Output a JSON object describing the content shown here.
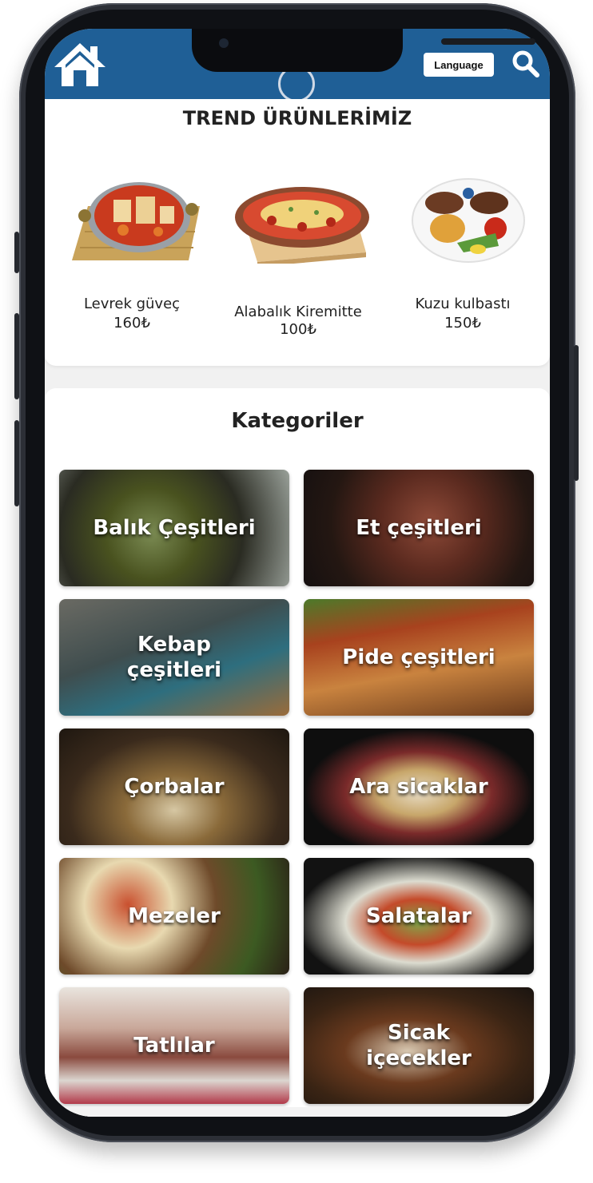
{
  "header": {
    "language_label": "Language",
    "home_icon": "home-icon",
    "search_icon": "search-icon",
    "bar_color": "#1f5f96"
  },
  "trend": {
    "title": "TREND ÜRÜNLERİMİZ",
    "items": [
      {
        "name": "Levrek güveç",
        "price": "160₺"
      },
      {
        "name": "Alabalık Kiremitte 100₺",
        "price": ""
      },
      {
        "name": "Kuzu kulbastı",
        "price": "150₺"
      }
    ]
  },
  "categories": {
    "title": "Kategoriler",
    "items": [
      {
        "label": "Balık Çeşitleri"
      },
      {
        "label": "Et çeşitleri"
      },
      {
        "label": "Kebap\nçeşitleri"
      },
      {
        "label": "Pide çeşitleri"
      },
      {
        "label": "Çorbalar"
      },
      {
        "label": "Ara sicaklar"
      },
      {
        "label": "Mezeler"
      },
      {
        "label": "Salatalar"
      },
      {
        "label": "Tatlılar"
      },
      {
        "label": "Sicak\niçecekler"
      }
    ]
  }
}
